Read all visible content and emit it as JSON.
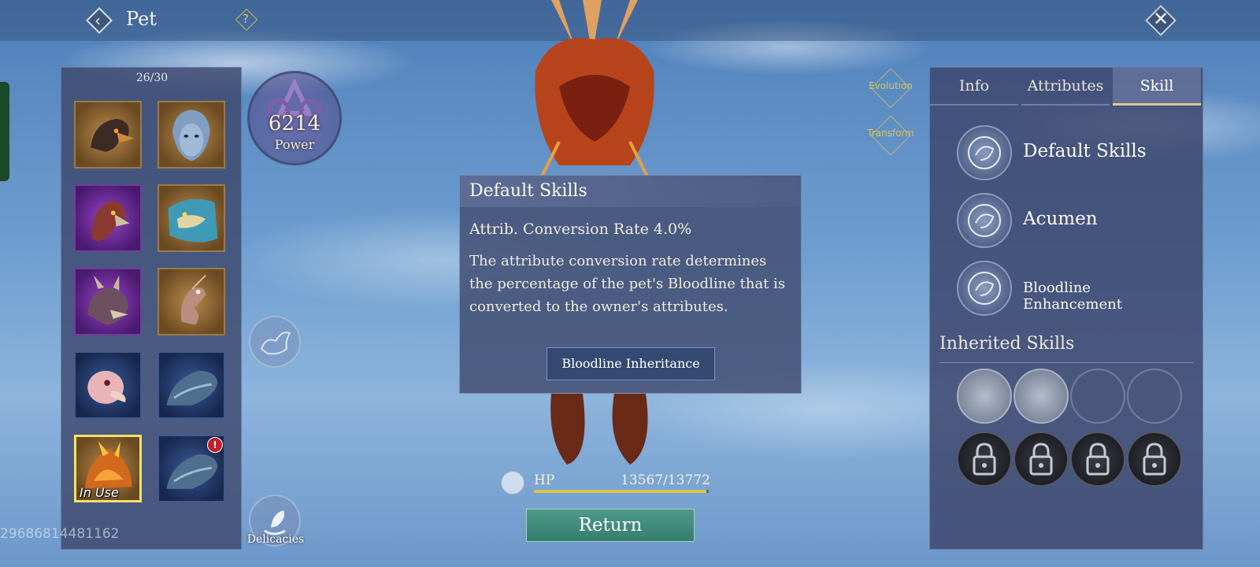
{
  "header": {
    "title": "Pet",
    "back_icon": "back-arrow-icon",
    "help_icon": "question-icon",
    "close_icon": "close-icon"
  },
  "pet_list": {
    "count": "26/30",
    "pets": [
      {
        "name": "dark-bird-pet",
        "frame": "bronze"
      },
      {
        "name": "silver-mask-pet",
        "frame": "bronze"
      },
      {
        "name": "red-eagle-pet",
        "frame": "purple"
      },
      {
        "name": "azure-dragon-pet",
        "frame": "bronze"
      },
      {
        "name": "horned-beast-pet",
        "frame": "purple"
      },
      {
        "name": "mantis-pet",
        "frame": "bronze"
      },
      {
        "name": "pink-bird-pet",
        "frame": "blue"
      },
      {
        "name": "blue-lizard-pet",
        "frame": "blue"
      },
      {
        "name": "fire-dragon-pet",
        "frame": "bronze",
        "selected": true,
        "tag": "In Use"
      },
      {
        "name": "blue-lizard-pet-2",
        "frame": "blue",
        "badge": "!"
      }
    ]
  },
  "power": {
    "value": "6214",
    "label": "Power"
  },
  "delicacies": {
    "label": "Delicacies"
  },
  "user_id": "29686814481162",
  "side_buttons": {
    "evolution": "Evolution",
    "transform": "Transform"
  },
  "tooltip": {
    "title": "Default Skills",
    "rate": "Attrib. Conversion Rate 4.0%",
    "description": "The attribute conversion rate determines the percentage of the pet's Bloodline that is converted to the owner's attributes.",
    "button": "Bloodline Inheritance"
  },
  "hp": {
    "label": "HP",
    "value": "13567/13772",
    "fraction": 0.985
  },
  "return_button": "Return",
  "right_panel": {
    "tabs": [
      "Info",
      "Attributes",
      "Skill"
    ],
    "active_tab": "Skill",
    "skills": [
      {
        "name": "Default Skills",
        "icon": "beast-head-icon"
      },
      {
        "name": "Acumen",
        "icon": "swirl-icon"
      },
      {
        "name": "Bloodline Enhancement",
        "icon": "swirl-icon"
      }
    ],
    "inherited_title": "Inherited Skills"
  },
  "colors": {
    "panel": "#3e486e",
    "accent_gold": "#d8cc8a",
    "hp_bar": "#d8c34a",
    "return_button": "#4f9a89",
    "in_use_frame": "#f1e26a"
  }
}
